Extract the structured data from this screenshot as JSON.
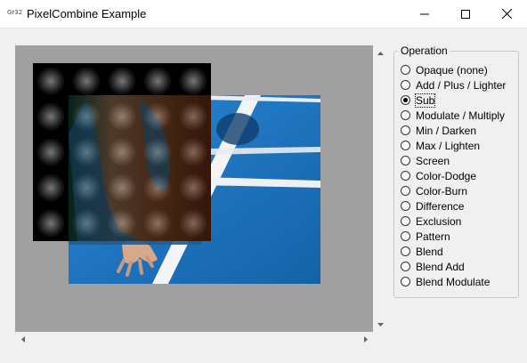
{
  "window": {
    "app_icon_text": "Gr32",
    "title": "PixelCombine Example",
    "controls": [
      "minimize-icon",
      "maximize-icon",
      "close-icon"
    ]
  },
  "group": {
    "legend": "Operation",
    "selected": "Sub",
    "options": [
      {
        "label": "Opaque (none)",
        "checked": false
      },
      {
        "label": "Add / Plus / Lighter",
        "checked": false
      },
      {
        "label": "Sub",
        "checked": true
      },
      {
        "label": "Modulate / Multiply",
        "checked": false
      },
      {
        "label": "Min / Darken",
        "checked": false
      },
      {
        "label": "Max / Lighten",
        "checked": false
      },
      {
        "label": "Screen",
        "checked": false
      },
      {
        "label": "Color-Dodge",
        "checked": false
      },
      {
        "label": "Color-Burn",
        "checked": false
      },
      {
        "label": "Difference",
        "checked": false
      },
      {
        "label": "Exclusion",
        "checked": false
      },
      {
        "label": "Pattern",
        "checked": false
      },
      {
        "label": "Blend",
        "checked": false
      },
      {
        "label": "Blend Add",
        "checked": false
      },
      {
        "label": "Blend Modulate",
        "checked": false
      }
    ]
  },
  "colors": {
    "viewport_bg": "#a0a0a0",
    "track_blue": "#1f78c4",
    "window_bg": "#f0f0f0"
  },
  "icons": {
    "scroll_up": "triangle-up-icon",
    "scroll_down": "triangle-down-icon",
    "scroll_left": "triangle-left-icon",
    "scroll_right": "triangle-right-icon"
  }
}
